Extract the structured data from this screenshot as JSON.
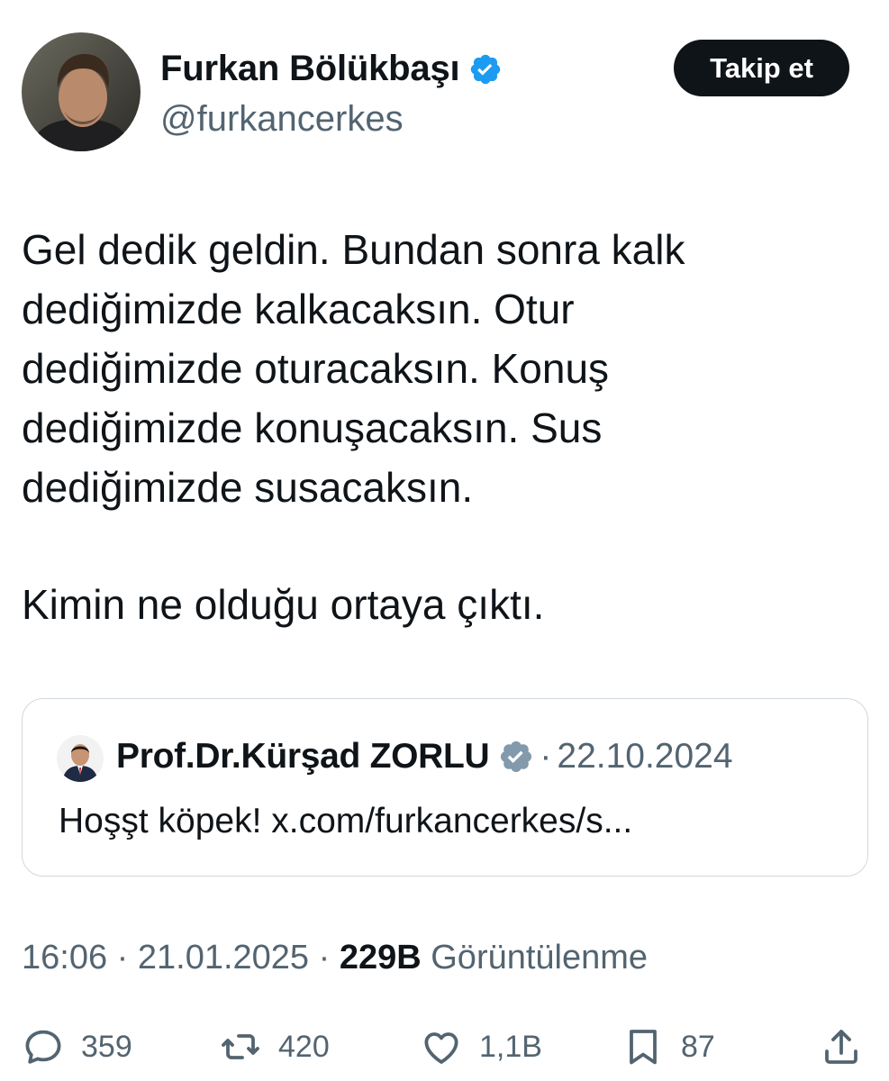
{
  "author": {
    "name": "Furkan Bölükbaşı",
    "handle": "@furkancerkes",
    "verified": true
  },
  "follow_button": {
    "label": "Takip et"
  },
  "tweet": {
    "lines_para1": [
      "Gel dedik geldin. Bundan sonra kalk",
      "dediğimizde kalkacaksın. Otur",
      "dediğimizde oturacaksın. Konuş",
      "dediğimizde konuşacaksın. Sus",
      "dediğimizde susacaksın."
    ],
    "line_para2": "Kimin ne olduğu ortaya çıktı."
  },
  "quote": {
    "name": "Prof.Dr.Kürşad ZORLU",
    "separator": "·",
    "date": "22.10.2024",
    "text": "Hoşşt köpek! x.com/furkancerkes/s..."
  },
  "meta": {
    "time": "16:06",
    "sep1": " · ",
    "date": "21.01.2025",
    "sep2": " · ",
    "views_count": "229B",
    "views_label": "Görüntülenme"
  },
  "actions": {
    "reply_count": "359",
    "retweet_count": "420",
    "like_count": "1,1B",
    "bookmark_count": "87"
  },
  "icons": {
    "verified_color": "#1d9bf0",
    "quote_verified_color": "#829aab"
  }
}
